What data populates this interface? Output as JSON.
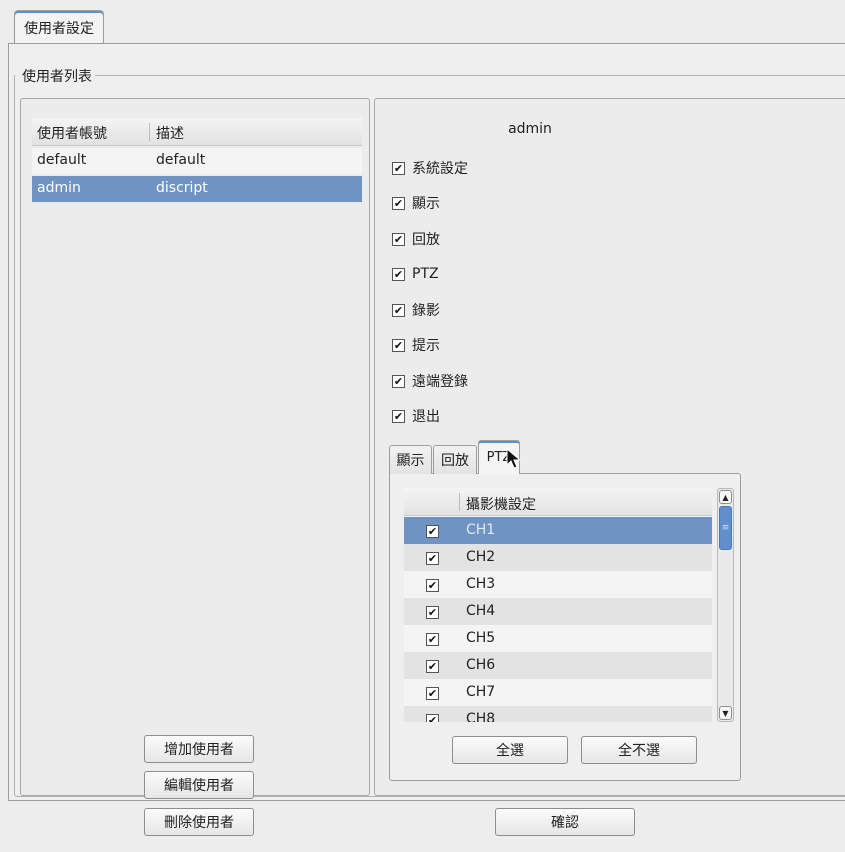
{
  "top_tab": {
    "label": "使用者設定"
  },
  "group": {
    "title": "使用者列表"
  },
  "user_table": {
    "headers": [
      "使用者帳號",
      "描述"
    ],
    "rows": [
      {
        "account": "default",
        "description": "default",
        "selected": false
      },
      {
        "account": "admin",
        "description": "discript",
        "selected": true
      }
    ]
  },
  "user_buttons": {
    "add": "增加使用者",
    "edit": "編輯使用者",
    "delete": "刪除使用者"
  },
  "detail": {
    "username": "admin",
    "permissions": [
      {
        "label": "系統設定",
        "checked": true
      },
      {
        "label": "顯示",
        "checked": true
      },
      {
        "label": "回放",
        "checked": true
      },
      {
        "label": "PTZ",
        "checked": true
      },
      {
        "label": "錄影",
        "checked": true
      },
      {
        "label": "提示",
        "checked": true
      },
      {
        "label": "遠端登錄",
        "checked": true
      },
      {
        "label": "退出",
        "checked": true
      }
    ],
    "sub_tabs": [
      "顯示",
      "回放",
      "PTZ"
    ],
    "active_sub_tab": "PTZ"
  },
  "camera_table": {
    "header": "攝影機設定",
    "rows": [
      {
        "label": "CH1",
        "checked": true,
        "selected": true
      },
      {
        "label": "CH2",
        "checked": true
      },
      {
        "label": "CH3",
        "checked": true
      },
      {
        "label": "CH4",
        "checked": true
      },
      {
        "label": "CH5",
        "checked": true
      },
      {
        "label": "CH6",
        "checked": true
      },
      {
        "label": "CH7",
        "checked": true
      },
      {
        "label": "CH8",
        "checked": true
      }
    ]
  },
  "camera_buttons": {
    "select_all": "全選",
    "select_none": "全不選"
  },
  "confirm_button": "確認",
  "icons": {
    "checkbox": "checkmark-icon",
    "scroll_up": "chevron-up-icon",
    "scroll_down": "chevron-down-icon",
    "cursor": "mouse-pointer-icon"
  },
  "colors": {
    "selection": "#6f94c4",
    "accent": "#5a8fc8"
  }
}
